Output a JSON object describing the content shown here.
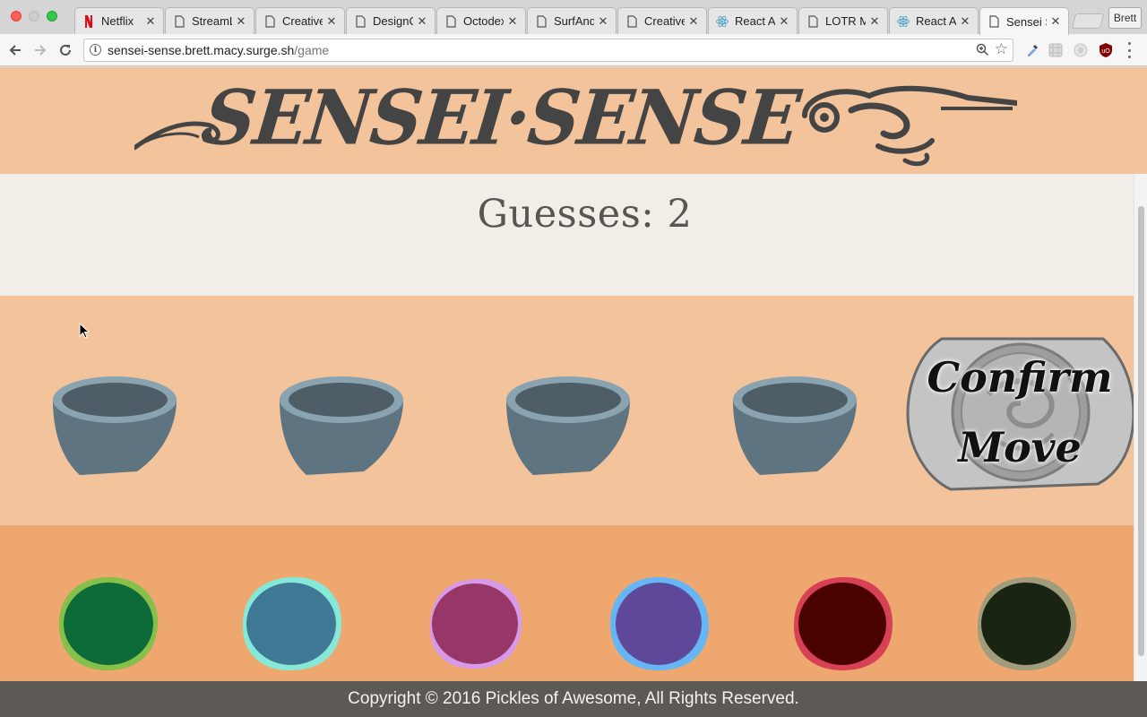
{
  "browser": {
    "tabs": [
      {
        "title": "Netflix",
        "icon": "netflix-icon"
      },
      {
        "title": "StreamL",
        "icon": "page-icon"
      },
      {
        "title": "Creative",
        "icon": "page-icon"
      },
      {
        "title": "DesignC",
        "icon": "page-icon"
      },
      {
        "title": "Octodex",
        "icon": "page-icon"
      },
      {
        "title": "SurfAnd",
        "icon": "page-icon"
      },
      {
        "title": "Creative",
        "icon": "page-icon"
      },
      {
        "title": "React Ap",
        "icon": "react-icon"
      },
      {
        "title": "LOTR M",
        "icon": "page-icon"
      },
      {
        "title": "React Ap",
        "icon": "react-icon"
      },
      {
        "title": "Sensei S",
        "icon": "page-icon",
        "active": true
      }
    ],
    "profile_label": "Brett",
    "url_host": "sensei-sense.brett.macy.surge.sh",
    "url_path": "/game"
  },
  "page": {
    "logo_text": "SENSEI·SENSE",
    "guesses_label": "Guesses:",
    "guesses_count": "2",
    "confirm_line1": "Confirm",
    "confirm_line2": "Move",
    "footer_text": "Copyright © 2016 Pickles of Awesome, All Rights Reserved."
  },
  "cups": [
    {
      "name": "cup-1",
      "filled": false
    },
    {
      "name": "cup-2",
      "filled": false
    },
    {
      "name": "cup-3",
      "filled": false
    },
    {
      "name": "cup-4",
      "filled": false
    }
  ],
  "orbs": [
    {
      "name": "green-orb",
      "fill": "#0d6b39",
      "ring": "#86c04b"
    },
    {
      "name": "teal-orb",
      "fill": "#3f7996",
      "ring": "#86e8d6"
    },
    {
      "name": "magenta-orb",
      "fill": "#983667",
      "ring": "#d69ae9"
    },
    {
      "name": "purple-orb",
      "fill": "#5e4899",
      "ring": "#66b6f5"
    },
    {
      "name": "maroon-orb",
      "fill": "#4a0200",
      "ring": "#d64156"
    },
    {
      "name": "black-orb",
      "fill": "#1a2413",
      "ring": "#a19c7c"
    }
  ],
  "colors": {
    "header_bg": "#f3c39c",
    "guess_bg": "#f1ede7",
    "cup_bg": "#f3c39c",
    "orb_bg": "#eea86f",
    "footer_bg": "#5d5955",
    "cup_body": "#5e7480",
    "cup_rim": "#8aa3b1",
    "cup_inside": "#4e5d66"
  }
}
